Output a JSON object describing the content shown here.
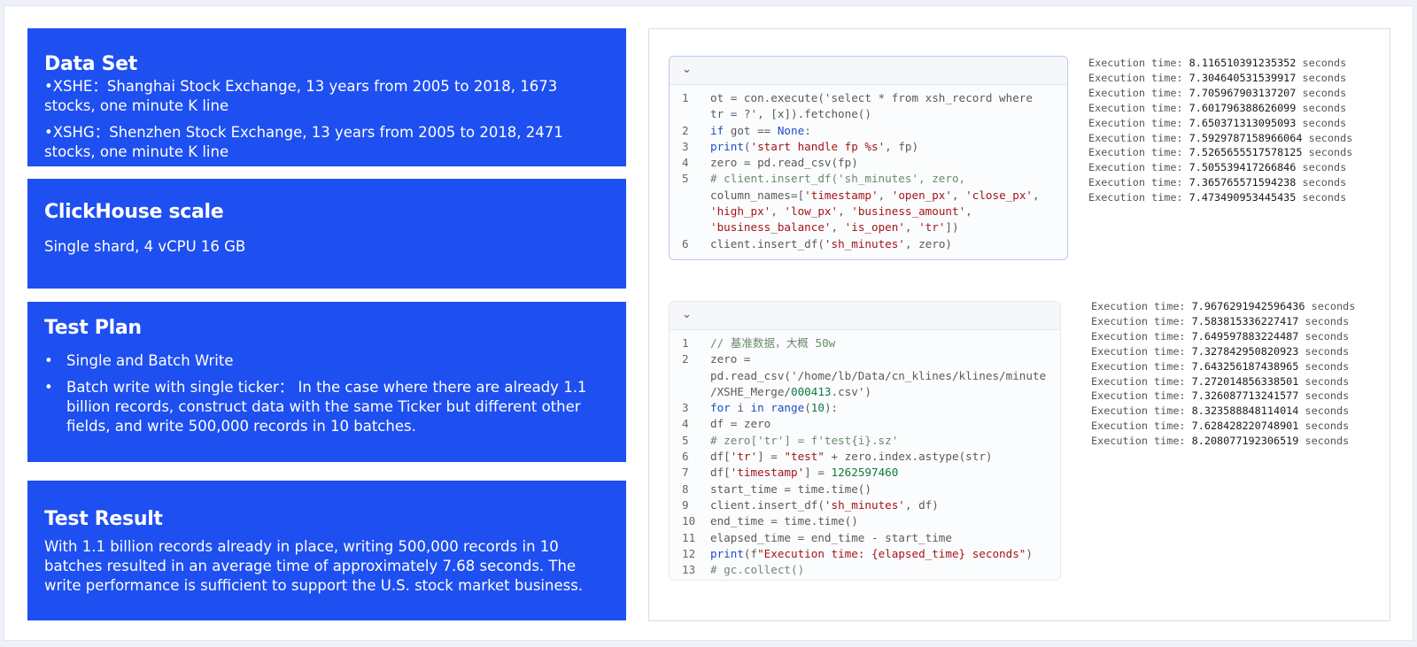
{
  "dataset": {
    "title": "Data Set",
    "lines": [
      "•XSHE：Shanghai Stock Exchange, 13 years from 2005 to 2018, 1673 stocks, one minute K line",
      "•XSHG：Shenzhen Stock Exchange, 13 years from 2005 to 2018, 2471 stocks, one minute K line"
    ]
  },
  "scale": {
    "title": "ClickHouse scale",
    "text": "Single shard, 4 vCPU 16 GB"
  },
  "plan": {
    "title": "Test Plan",
    "bullet": "•",
    "items": [
      "Single and Batch Write",
      "Batch write with single ticker： In the case where there are already 1.1 billion records, construct data with the same Ticker but different other fields, and write 500,000 records in 10 batches."
    ]
  },
  "result": {
    "title": "Test Result",
    "text": "With 1.1 billion records already in place, writing 500,000 records in 10 batches resulted in an average time of approximately 7.68 seconds. The write performance is sufficient to support the U.S. stock market business."
  },
  "cell1": {
    "chevron": "⌄",
    "line_numbers": [
      "1",
      "",
      "2",
      "3",
      "4",
      "5",
      "",
      "",
      "",
      "6"
    ],
    "lines": [
      "ot = con.execute('select * from xsh_record where",
      "tr = ?', [x]).fetchone()",
      "if got == None:",
      "print('start handle fp %s', fp)",
      "zero = pd.read_csv(fp)",
      "# client.insert_df('sh_minutes', zero,",
      "column_names=['timestamp', 'open_px', 'close_px',",
      "'high_px', 'low_px', 'business_amount',",
      "'business_balance', 'is_open', 'tr'])",
      "client.insert_df('sh_minutes', zero)"
    ]
  },
  "cell2": {
    "chevron": "⌄",
    "line_numbers": [
      "1",
      "2",
      "",
      "",
      "3",
      "4",
      "5",
      "6",
      "7",
      "8",
      "9",
      "10",
      "11",
      "12",
      "13"
    ],
    "lines": [
      "// 基准数据，大概 50w",
      "zero =",
      "pd.read_csv('/home/lb/Data/cn_klines/klines/minute",
      "/XSHE_Merge/000413.csv')",
      "for i in range(10):",
      "df = zero",
      "# zero['tr'] = f'test{i}.sz'",
      "df['tr'] = \"test\" + zero.index.astype(str)",
      "df['timestamp'] = 1262597460",
      "start_time = time.time()",
      "client.insert_df('sh_minutes', df)",
      "end_time = time.time()",
      "elapsed_time = end_time - start_time",
      "print(f\"Execution time: {elapsed_time} seconds\")",
      "# gc.collect()"
    ]
  },
  "output1": {
    "prefix": "Execution time: ",
    "suffix": " seconds",
    "values": [
      "8.116510391235352",
      "7.304640531539917",
      "7.705967903137207",
      "7.601796388626099",
      "7.650371313095093",
      "7.5929787158966064",
      "7.5265655517578125",
      "7.505539417266846",
      "7.365765571594238",
      "7.473490953445435"
    ]
  },
  "output2": {
    "prefix": "Execution time: ",
    "suffix": " seconds",
    "values": [
      "7.9676291942596436",
      "7.583815336227417",
      "7.649597883224487",
      "7.327842950820923",
      "7.643256187438965",
      "7.272014856338501",
      "7.326087713241577",
      "8.323588848114014",
      "7.628428220748901",
      "8.208077192306519"
    ]
  }
}
